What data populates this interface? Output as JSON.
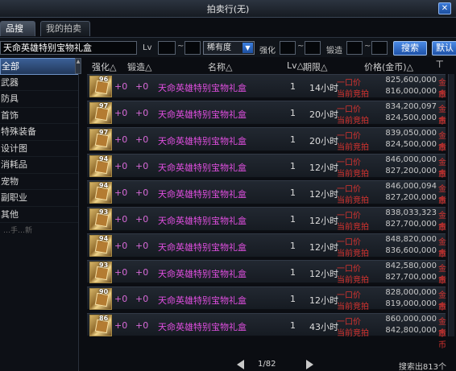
{
  "window": {
    "title": "拍卖行(无)",
    "close_label": "✕"
  },
  "tabs": [
    "品搜索",
    "我的拍卖品"
  ],
  "toolbar": {
    "search_value": "天命英雄特别宝物礼盒",
    "lv_label": "Lv",
    "tilde": "~",
    "rarity_value": "稀有度",
    "enhance_label": "强化",
    "forge_label": "锻造",
    "search_button": "搜索",
    "default_button": "默认"
  },
  "sidebar": {
    "items": [
      "全部",
      "武器",
      "防具",
      "首饰",
      "特殊装备",
      "设计图",
      "消耗品",
      "宠物",
      "副职业",
      "其他"
    ],
    "note": "…手…新"
  },
  "table": {
    "headers": {
      "enhance": "强化△",
      "forge": "锻造△",
      "name": "名称△",
      "level": "Lv△",
      "duration": "期限△",
      "price": "价格(金币)△"
    },
    "price_labels": {
      "buyout": "一口价",
      "current_bid": "当前竞拍",
      "unit": "金币"
    },
    "rows": [
      {
        "badge": "96",
        "enhance": "+0",
        "forge": "+0",
        "name": "天命英雄特别宝物礼盒",
        "qty": "1",
        "duration": "14小时",
        "buyout": "825,600,000",
        "bid": "816,000,000"
      },
      {
        "badge": "97",
        "enhance": "+0",
        "forge": "+0",
        "name": "天命英雄特别宝物礼盒",
        "qty": "1",
        "duration": "20小时",
        "buyout": "834,200,097",
        "bid": "824,500,000"
      },
      {
        "badge": "97",
        "enhance": "+0",
        "forge": "+0",
        "name": "天命英雄特别宝物礼盒",
        "qty": "1",
        "duration": "20小时",
        "buyout": "839,050,000",
        "bid": "824,500,000"
      },
      {
        "badge": "94",
        "enhance": "+0",
        "forge": "+0",
        "name": "天命英雄特别宝物礼盒",
        "qty": "1",
        "duration": "12小时",
        "buyout": "846,000,000",
        "bid": "827,200,000"
      },
      {
        "badge": "94",
        "enhance": "+0",
        "forge": "+0",
        "name": "天命英雄特别宝物礼盒",
        "qty": "1",
        "duration": "12小时",
        "buyout": "846,000,094",
        "bid": "827,200,000"
      },
      {
        "badge": "93",
        "enhance": "+0",
        "forge": "+0",
        "name": "天命英雄特别宝物礼盒",
        "qty": "1",
        "duration": "12小时",
        "buyout": "838,033,323",
        "bid": "827,700,000"
      },
      {
        "badge": "94",
        "enhance": "+0",
        "forge": "+0",
        "name": "天命英雄特别宝物礼盒",
        "qty": "1",
        "duration": "12小时",
        "buyout": "848,820,000",
        "bid": "836,600,000"
      },
      {
        "badge": "93",
        "enhance": "+0",
        "forge": "+0",
        "name": "天命英雄特别宝物礼盒",
        "qty": "1",
        "duration": "12小时",
        "buyout": "842,580,000",
        "bid": "827,700,000"
      },
      {
        "badge": "90",
        "enhance": "+0",
        "forge": "+0",
        "name": "天命英雄特别宝物礼盒",
        "qty": "1",
        "duration": "12小时",
        "buyout": "828,000,000",
        "bid": "819,000,000"
      },
      {
        "badge": "86",
        "enhance": "+0",
        "forge": "+0",
        "name": "天命英雄特别宝物礼盒",
        "qty": "1",
        "duration": "43小时",
        "buyout": "860,000,000",
        "bid": "842,800,000"
      }
    ]
  },
  "footer": {
    "page": "1/82",
    "result_count": "搜索出813个"
  },
  "colors": {
    "item_name": "#e14fe1",
    "price_label": "#d8332f",
    "selected_category": "#3b5f96"
  }
}
